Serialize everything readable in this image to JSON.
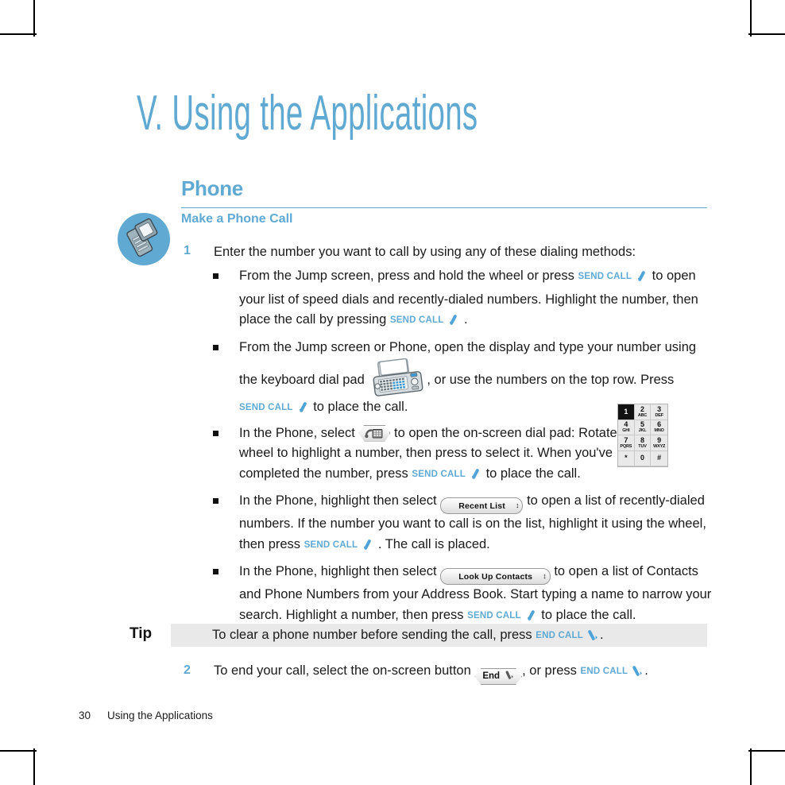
{
  "chapter": {
    "title": "V. Using the Applications"
  },
  "section": {
    "title": "Phone"
  },
  "subsection": {
    "title": "Make a Phone Call"
  },
  "margin_icon": {
    "name": "phone-device-icon",
    "circle_color": "#5FA9D3"
  },
  "colors": {
    "accent_blue": "#5FA9D3",
    "body_text": "#1a1a1a",
    "tip_band": "#e9e9e9"
  },
  "keys": {
    "send_call": "SEND CALL",
    "end_call": "END CALL"
  },
  "steps": [
    {
      "number": "1",
      "text": "Enter the number you want to call by using any of these dialing methods:",
      "bullets": [
        {
          "parts": [
            "From the Jump screen, press and hold the wheel or press ",
            "|SEND|",
            " to open your list of speed dials and recently-dialed numbers. Highlight the number, then place the call by pressing ",
            "|SEND|",
            " ."
          ]
        },
        {
          "parts": [
            "From the Jump screen or Phone, open the display and type your number using the keyboard dial pad ",
            "|DEVICE|",
            ", or use the numbers on the top row. Press ",
            "|SEND|",
            " to place the call."
          ]
        },
        {
          "parts": [
            "In the Phone, select ",
            "|DIALBTN|",
            " to open the on-screen dial pad: Rotate the wheel to highlight a number, then press to select it. When you've completed the number, press ",
            "|SEND|",
            " to place the call."
          ]
        },
        {
          "parts": [
            "In the Phone, highlight then select ",
            "|POPUP:Recent List|",
            " to open a list of recently-dialed numbers. If the number you want to call is on the list, highlight it using the wheel, then press ",
            "|SEND|",
            " . The call is placed."
          ]
        },
        {
          "parts": [
            "In the Phone, highlight then select ",
            "|POPUP:Look Up Contacts|",
            " to open a list of Contacts and Phone Numbers from your Address Book. Start typing a name to narrow your search. Highlight a number, then press ",
            "|SEND|",
            " to place the call."
          ]
        }
      ]
    }
  ],
  "tip": {
    "label": "Tip",
    "text_before": "To clear a phone number before sending the call, press ",
    "text_after": "."
  },
  "step2": {
    "number": "2",
    "text_before": "To end your call, select the on-screen button ",
    "button_label": "End",
    "text_middle": ", or press ",
    "text_after": "."
  },
  "dialpad": {
    "name": "on-screen-dial-pad",
    "keys": [
      {
        "digit": "1",
        "letters": "",
        "selected": true
      },
      {
        "digit": "2",
        "letters": "ABC",
        "selected": false
      },
      {
        "digit": "3",
        "letters": "DEF",
        "selected": false
      },
      {
        "digit": "4",
        "letters": "GHI",
        "selected": false
      },
      {
        "digit": "5",
        "letters": "JKL",
        "selected": false
      },
      {
        "digit": "6",
        "letters": "MNO",
        "selected": false
      },
      {
        "digit": "7",
        "letters": "PQRS",
        "selected": false
      },
      {
        "digit": "8",
        "letters": "TUV",
        "selected": false
      },
      {
        "digit": "9",
        "letters": "WXYZ",
        "selected": false
      },
      {
        "digit": "*",
        "letters": "",
        "selected": false
      },
      {
        "digit": "0",
        "letters": "",
        "selected": false
      },
      {
        "digit": "#",
        "letters": "",
        "selected": false
      }
    ]
  },
  "footer": {
    "page_number": "30",
    "text": "Using the Applications"
  }
}
